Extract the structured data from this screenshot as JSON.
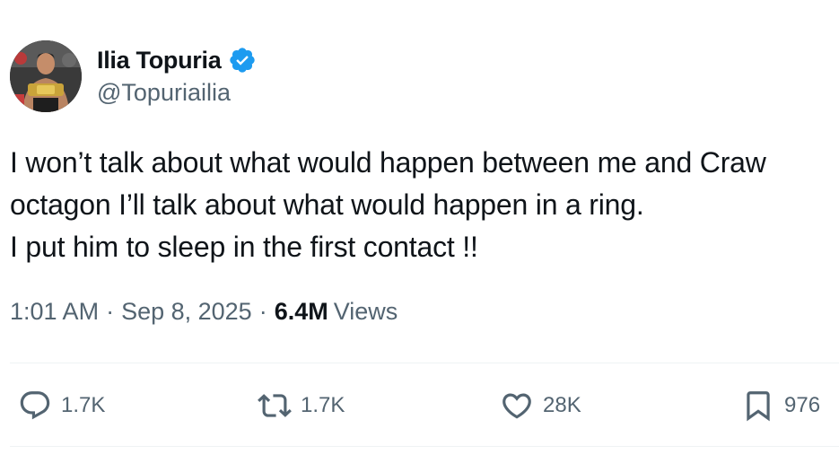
{
  "author": {
    "display_name": "Ilia Topuria",
    "handle": "@Topuriailia",
    "verified": true,
    "verified_color": "#1d9bf0"
  },
  "tweet": {
    "lines": [
      "I won’t talk about what would happen between me and Craw",
      "octagon I’ll talk about what would happen in a ring.",
      "I put him to sleep in the first contact !!"
    ]
  },
  "meta": {
    "time": "1:01 AM",
    "separator": "·",
    "date": "Sep 8, 2025",
    "views_count": "6.4M",
    "views_label": "Views"
  },
  "actions": {
    "reply": {
      "icon": "reply-icon",
      "count": "1.7K"
    },
    "retweet": {
      "icon": "retweet-icon",
      "count": "1.7K"
    },
    "like": {
      "icon": "heart-icon",
      "count": "28K"
    },
    "bookmark": {
      "icon": "bookmark-icon",
      "count": "976"
    }
  }
}
